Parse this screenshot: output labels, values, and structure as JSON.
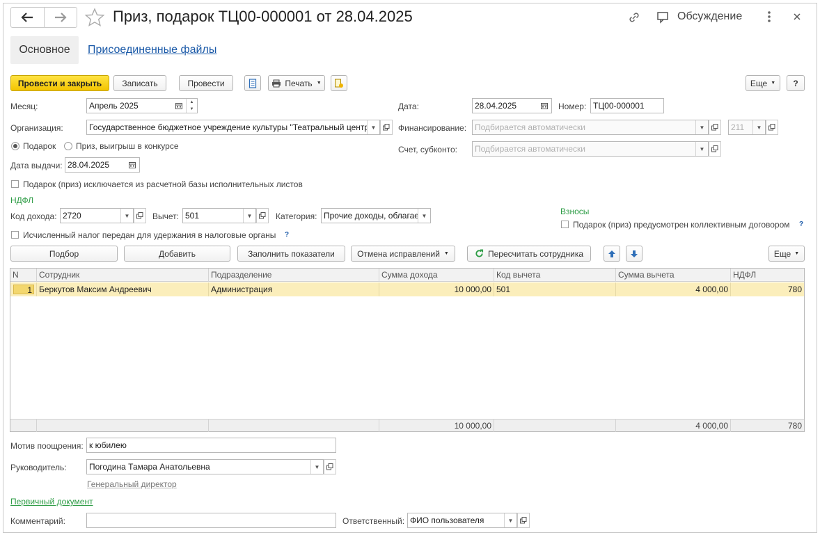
{
  "header": {
    "title": "Приз, подарок ТЦ00-000001 от 28.04.2025",
    "discussion_label": "Обсуждение"
  },
  "tabs": {
    "main": "Основное",
    "files": "Присоединенные файлы"
  },
  "toolbar": {
    "post_close": "Провести и закрыть",
    "save": "Записать",
    "post": "Провести",
    "print": "Печать",
    "more": "Еще",
    "help": "?"
  },
  "form": {
    "month_label": "Месяц:",
    "month_value": "Апрель 2025",
    "date_label": "Дата:",
    "date_value": "28.04.2025",
    "number_label": "Номер:",
    "number_value": "ТЦ00-000001",
    "org_label": "Организация:",
    "org_value": "Государственное бюджетное учреждение культуры \"Театральный центр\"",
    "financing_label": "Финансирование:",
    "financing_placeholder": "Подбирается автоматически",
    "financing_code": "211",
    "account_label": "Счет, субконто:",
    "account_placeholder": "Подбирается автоматически",
    "radio_gift": "Подарок",
    "radio_prize": "Приз, выигрыш в конкурсе",
    "issue_date_label": "Дата выдачи:",
    "issue_date_value": "28.04.2025",
    "exclude_label": "Подарок (приз) исключается из расчетной базы исполнительных листов",
    "ndfl_section": "НДФЛ",
    "income_code_label": "Код дохода:",
    "income_code_value": "2720",
    "deduction_label": "Вычет:",
    "deduction_value": "501",
    "category_label": "Категория:",
    "category_value": "Прочие доходы, облагаемые",
    "contrib_section": "Взносы",
    "contrib_label": "Подарок (приз) предусмотрен коллективным договором",
    "tax_sent_label": "Исчисленный налог передан для удержания в налоговые органы",
    "help_mark": "?"
  },
  "table_toolbar": {
    "pick": "Подбор",
    "add": "Добавить",
    "fill": "Заполнить показатели",
    "cancel_fix": "Отмена исправлений",
    "recalc": "Пересчитать сотрудника",
    "more": "Еще"
  },
  "table": {
    "columns": [
      "N",
      "Сотрудник",
      "Подразделение",
      "Сумма дохода",
      "Код вычета",
      "Сумма вычета",
      "НДФЛ"
    ],
    "rows": [
      {
        "n": "1",
        "employee": "Беркутов Максим Андреевич",
        "department": "Администрация",
        "income": "10 000,00",
        "deduction_code": "501",
        "deduction_sum": "4 000,00",
        "ndfl": "780"
      }
    ],
    "totals": {
      "income": "10 000,00",
      "deduction_sum": "4 000,00",
      "ndfl": "780"
    }
  },
  "footer": {
    "motive_label": "Мотив поощрения:",
    "motive_value": "к юбилею",
    "head_label": "Руководитель:",
    "head_value": "Погодина Тамара Анатольевна",
    "head_position": "Генеральный директор",
    "primary_doc": "Первичный документ",
    "comment_label": "Комментарий:",
    "comment_value": "",
    "responsible_label": "Ответственный:",
    "responsible_value": "ФИО пользователя"
  },
  "colors": {
    "primary_button": "#f3c400",
    "selected_row": "#fbeebb",
    "link": "#1a59a8",
    "section_green": "#2d9c45"
  }
}
